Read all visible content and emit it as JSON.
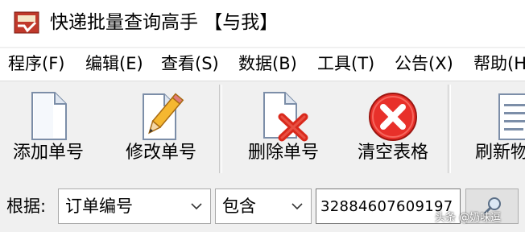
{
  "window": {
    "title": "快递批量查询高手 【与我】"
  },
  "menu": [
    {
      "label": "程序(F)"
    },
    {
      "label": "编辑(E)"
    },
    {
      "label": "查看(S)"
    },
    {
      "label": "数据(B)"
    },
    {
      "label": "工具(T)"
    },
    {
      "label": "公告(X)"
    },
    {
      "label": "帮助(H"
    }
  ],
  "toolbar": {
    "add_label": "添加单号",
    "edit_label": "修改单号",
    "delete_label": "删除单号",
    "clear_label": "清空表格",
    "refresh_label": "刷新物"
  },
  "search": {
    "label": "根据:",
    "field_value": "订单编号",
    "match_value": "包含",
    "input_value": "32884607609197"
  },
  "watermark": {
    "text": "头条 @奶味逗"
  },
  "colors": {
    "delete_red": "#d9291c",
    "clear_red": "#e8302a",
    "pencil_yellow": "#f5b731",
    "background": "#f0f0f0"
  },
  "icons": {
    "app": "app-icon",
    "add": "blank-document-icon",
    "edit": "document-pencil-icon",
    "delete": "document-red-x-icon",
    "clear": "red-circle-x-icon",
    "refresh": "document-lines-icon",
    "search": "magnifier-icon",
    "dropdown": "chevron-down-icon"
  }
}
